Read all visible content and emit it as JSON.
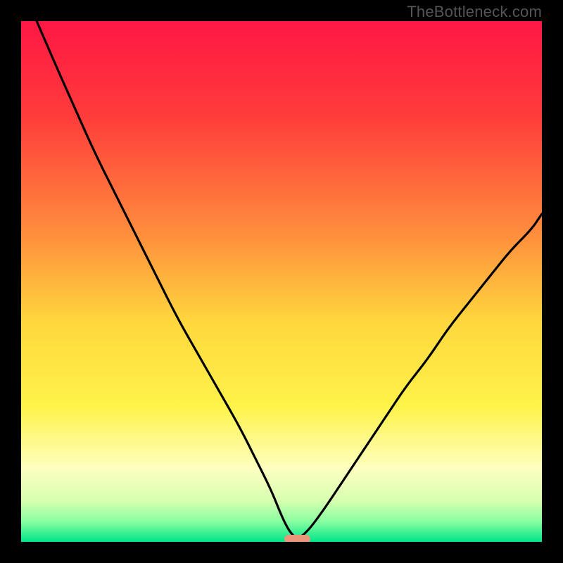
{
  "attribution": "TheBottleneck.com",
  "chart_data": {
    "type": "line",
    "title": "",
    "xlabel": "",
    "ylabel": "",
    "xlim": [
      0,
      100
    ],
    "ylim": [
      0,
      100
    ],
    "series": [
      {
        "name": "bottleneck-curve",
        "x": [
          3,
          6,
          10,
          14,
          18,
          22,
          26,
          30,
          34,
          38,
          42,
          45,
          48,
          50,
          51.5,
          53,
          55,
          58,
          62,
          66,
          70,
          74,
          78,
          82,
          86,
          90,
          94,
          98,
          100
        ],
        "y": [
          100,
          93,
          84,
          75,
          67,
          59,
          51,
          43,
          36,
          29,
          22,
          16,
          10,
          5,
          2,
          0.5,
          2,
          6,
          12,
          18,
          24,
          30,
          35,
          41,
          46,
          51,
          56,
          60,
          63
        ]
      }
    ],
    "marker": {
      "x": 53,
      "y": 0.5,
      "width_pct": 5,
      "height_pct": 1.6
    },
    "gradient_stops": [
      {
        "offset": 0,
        "color": "#ff1744"
      },
      {
        "offset": 0.18,
        "color": "#ff3b3b"
      },
      {
        "offset": 0.4,
        "color": "#ff8a3d"
      },
      {
        "offset": 0.58,
        "color": "#ffd83d"
      },
      {
        "offset": 0.74,
        "color": "#fff34a"
      },
      {
        "offset": 0.86,
        "color": "#fdffc0"
      },
      {
        "offset": 0.92,
        "color": "#d8ffb0"
      },
      {
        "offset": 0.96,
        "color": "#8affa0"
      },
      {
        "offset": 1.0,
        "color": "#00e58a"
      }
    ]
  }
}
